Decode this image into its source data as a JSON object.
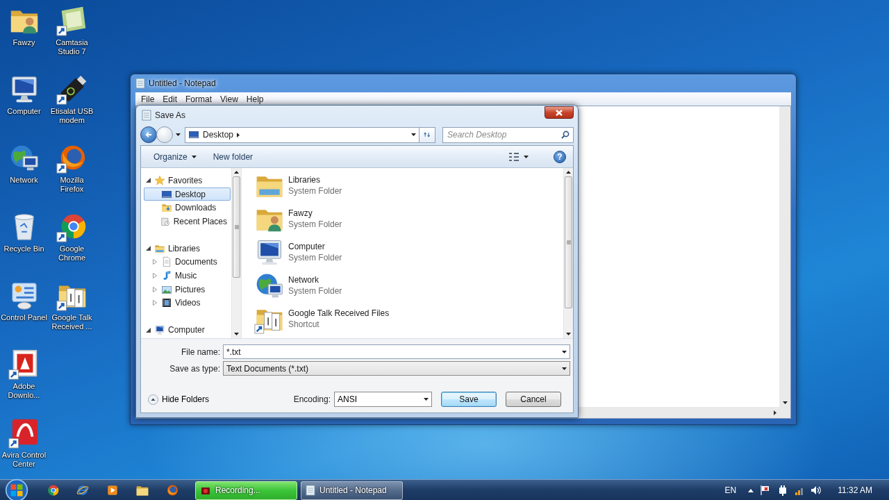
{
  "desktop_icons": [
    {
      "label": "Fawzy",
      "kind": "user-folder"
    },
    {
      "label": "Computer",
      "kind": "computer"
    },
    {
      "label": "Network",
      "kind": "network"
    },
    {
      "label": "Recycle Bin",
      "kind": "recycle"
    },
    {
      "label": "Control Panel",
      "kind": "control"
    },
    {
      "label": "Adobe Downlo...",
      "kind": "adobe"
    },
    {
      "label": "Avira Control Center",
      "kind": "avira"
    },
    {
      "label": "Camtasia Studio 7",
      "kind": "camtasia"
    },
    {
      "label": "Etisalat USB modem",
      "kind": "usb"
    },
    {
      "label": "Mozilla Firefox",
      "kind": "firefox"
    },
    {
      "label": "Google Chrome",
      "kind": "chrome"
    },
    {
      "label": "Google Talk Received ...",
      "kind": "shortcut-folder"
    }
  ],
  "notepad": {
    "title": "Untitled - Notepad",
    "menu": [
      "File",
      "Edit",
      "Format",
      "View",
      "Help"
    ]
  },
  "save_dialog": {
    "title": "Save As",
    "address": "Desktop",
    "search": {
      "placeholder": "Search Desktop"
    },
    "toolbar": {
      "organize": "Organize",
      "new_folder": "New folder",
      "help": "?"
    },
    "nav_tree": [
      {
        "label": "Favorites",
        "kind": "star",
        "expanded": true,
        "selected": false,
        "children": [
          {
            "label": "Desktop",
            "kind": "desktop",
            "selected": true
          },
          {
            "label": "Downloads",
            "kind": "downloads",
            "selected": false
          },
          {
            "label": "Recent Places",
            "kind": "recent",
            "selected": false
          }
        ]
      },
      {
        "label": "Libraries",
        "kind": "libraries",
        "expanded": true,
        "selected": false,
        "children": [
          {
            "label": "Documents",
            "kind": "documents",
            "expanded": false,
            "selected": false
          },
          {
            "label": "Music",
            "kind": "music",
            "expanded": false,
            "selected": false
          },
          {
            "label": "Pictures",
            "kind": "pictures",
            "expanded": false,
            "selected": false
          },
          {
            "label": "Videos",
            "kind": "videos",
            "expanded": false,
            "selected": false
          }
        ]
      },
      {
        "label": "Computer",
        "kind": "computer",
        "expanded": true,
        "selected": false
      }
    ],
    "files": [
      {
        "name": "Libraries",
        "type": "System Folder",
        "kind": "libraries"
      },
      {
        "name": "Fawzy",
        "type": "System Folder",
        "kind": "user-folder"
      },
      {
        "name": "Computer",
        "type": "System Folder",
        "kind": "computer"
      },
      {
        "name": "Network",
        "type": "System Folder",
        "kind": "network"
      },
      {
        "name": "Google Talk Received Files",
        "type": "Shortcut",
        "kind": "shortcut-folder"
      }
    ],
    "file_name": {
      "label": "File name:",
      "value": "*.txt"
    },
    "save_as_type": {
      "label": "Save as type:",
      "value": "Text Documents (*.txt)"
    },
    "hide_folders": "Hide Folders",
    "encoding": {
      "label": "Encoding:",
      "value": "ANSI"
    },
    "buttons": [
      {
        "label": "Save",
        "default": true
      },
      {
        "label": "Cancel",
        "default": false
      }
    ]
  },
  "taskbar": {
    "tasks": [
      {
        "label": "Recording...",
        "flashing": true
      },
      {
        "label": "Untitled - Notepad",
        "flashing": false
      }
    ],
    "language": "EN",
    "clock": "11:32 AM"
  }
}
